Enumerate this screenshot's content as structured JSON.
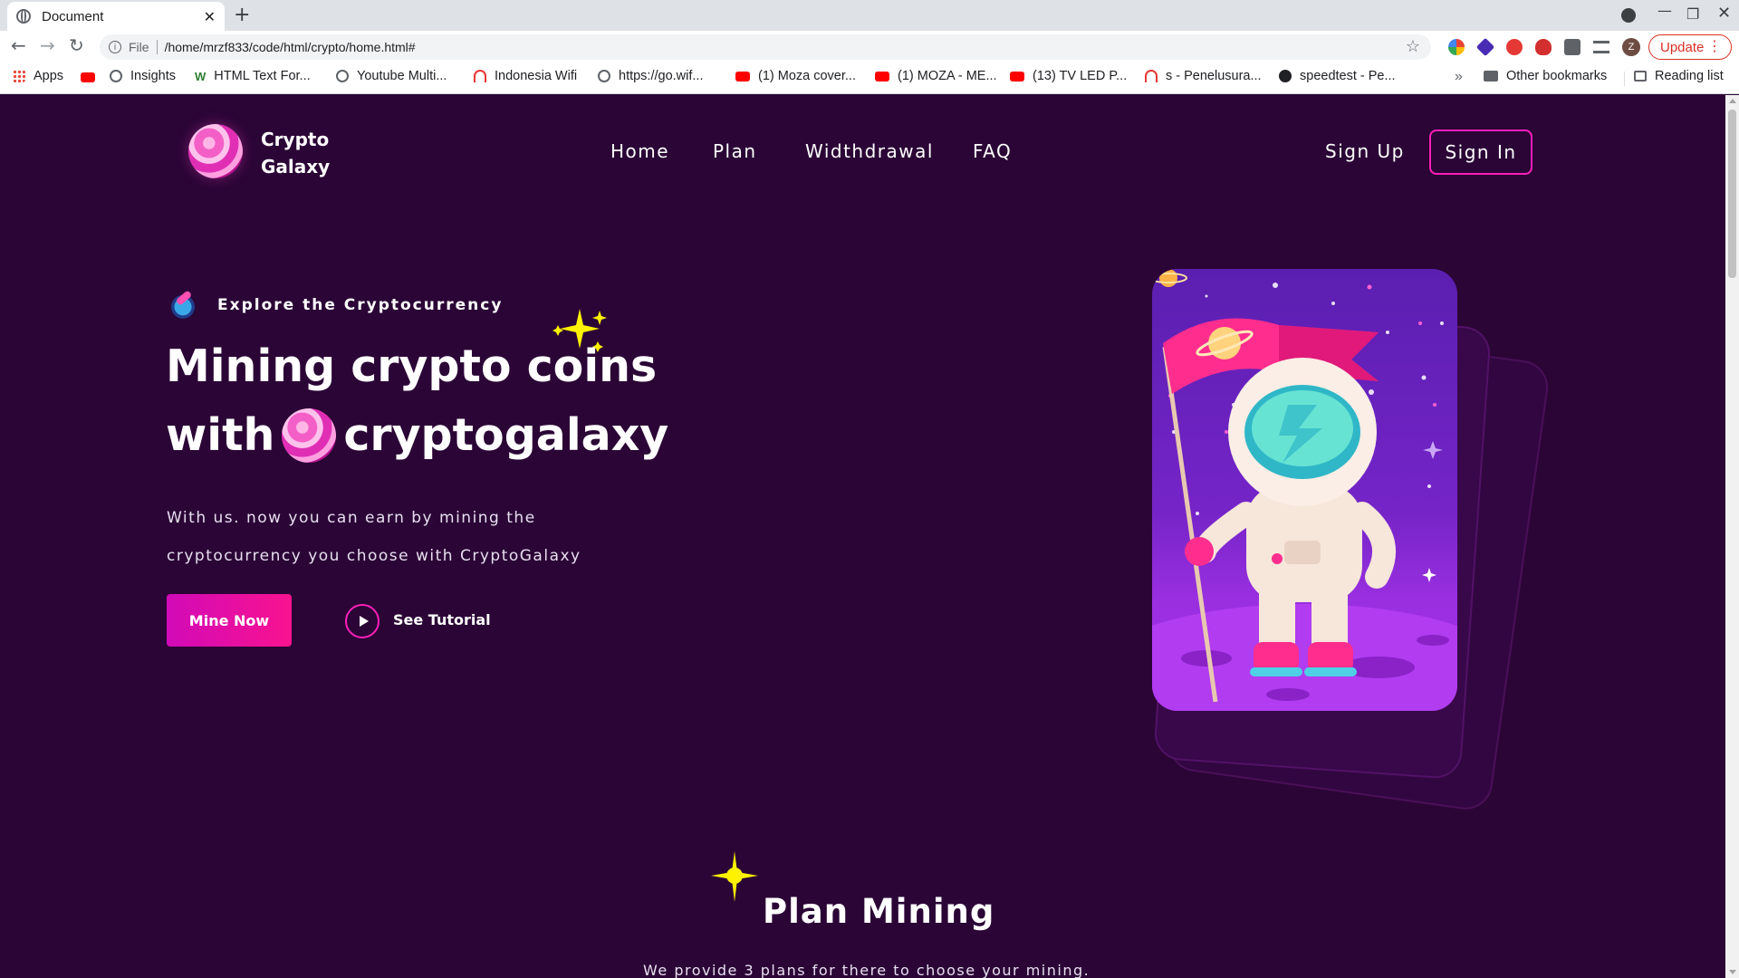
{
  "browser": {
    "tab_title": "Document",
    "url_scheme": "File",
    "url": "/home/mrzf833/code/html/crypto/home.html#",
    "update_label": "Update",
    "avatar_letter": "Z",
    "bookmarks": [
      {
        "label": "Apps",
        "icon": "apps-icon"
      },
      {
        "label": "",
        "icon": "youtube-icon"
      },
      {
        "label": "Insights",
        "icon": "globe-icon"
      },
      {
        "label": "HTML Text For...",
        "icon": "w-icon"
      },
      {
        "label": "Youtube Multi...",
        "icon": "globe-icon"
      },
      {
        "label": "Indonesia Wifi",
        "icon": "wifi-icon"
      },
      {
        "label": "https://go.wif...",
        "icon": "globe-icon"
      },
      {
        "label": "(1) Moza cover...",
        "icon": "youtube-icon"
      },
      {
        "label": "(1) MOZA - ME...",
        "icon": "youtube-icon"
      },
      {
        "label": "(13) TV LED P...",
        "icon": "youtube-icon"
      },
      {
        "label": "s - Penelusura...",
        "icon": "wifi-icon"
      },
      {
        "label": "speedtest - Pe...",
        "icon": "speedtest-icon"
      }
    ],
    "more_bookmarks": "»",
    "other_bookmarks": "Other bookmarks",
    "reading_list": "Reading list"
  },
  "site": {
    "logo_line1": "Crypto",
    "logo_line2": "Galaxy",
    "nav": [
      "Home",
      "Plan",
      "Widthdrawal",
      "FAQ"
    ],
    "sign_up": "Sign Up",
    "sign_in": "Sign In"
  },
  "hero": {
    "badge": "Explore the Cryptocurrency",
    "title_line1": "Mining crypto coins",
    "title_line2_a": "with",
    "title_line2_b": "cryptogalaxy",
    "desc_line1": "With us. now you can earn by mining the",
    "desc_line2": "cryptocurrency you choose with CryptoGalaxy",
    "cta_primary": "Mine Now",
    "cta_secondary": "See Tutorial"
  },
  "plan_section": {
    "title": "Plan Mining",
    "subtitle": "We provide 3 plans for there to choose your mining."
  },
  "colors": {
    "page_bg": "#2b0536",
    "accent": "#ff1fb8",
    "sparkle": "#fff200"
  }
}
